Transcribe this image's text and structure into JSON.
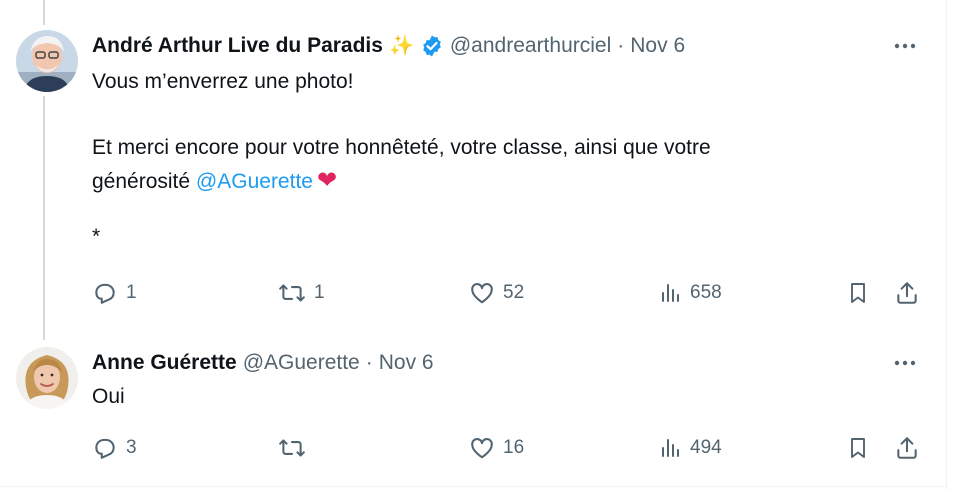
{
  "tweets": [
    {
      "author": {
        "display_name": "André Arthur Live du Paradis",
        "emoji": "✨",
        "verified": true,
        "handle": "@andrearthurciel"
      },
      "separator": "·",
      "date": "Nov 6",
      "text_lines": [
        "Vous m’enverrez une photo!",
        "Et merci encore pour votre honnêteté, votre classe, ainsi que votre",
        "générosité",
        "*"
      ],
      "mention": "@AGuerette",
      "heart": "❤",
      "stats": {
        "replies": "1",
        "retweets": "1",
        "likes": "52",
        "views": "658"
      }
    },
    {
      "author": {
        "display_name": "Anne Guérette",
        "handle": "@AGuerette"
      },
      "separator": "·",
      "date": "Nov 6",
      "text_lines": [
        "Oui"
      ],
      "stats": {
        "replies": "3",
        "retweets": "",
        "likes": "16",
        "views": "494"
      }
    }
  ],
  "colors": {
    "text": "#0f1419",
    "secondary": "#536471",
    "link": "#1d9bf0",
    "verified": "#1d9bf0",
    "thread_line": "#cfd9de"
  },
  "icons": [
    "reply-icon",
    "retweet-icon",
    "like-icon",
    "views-icon",
    "bookmark-icon",
    "share-icon",
    "more-icon",
    "verified-badge-icon"
  ]
}
